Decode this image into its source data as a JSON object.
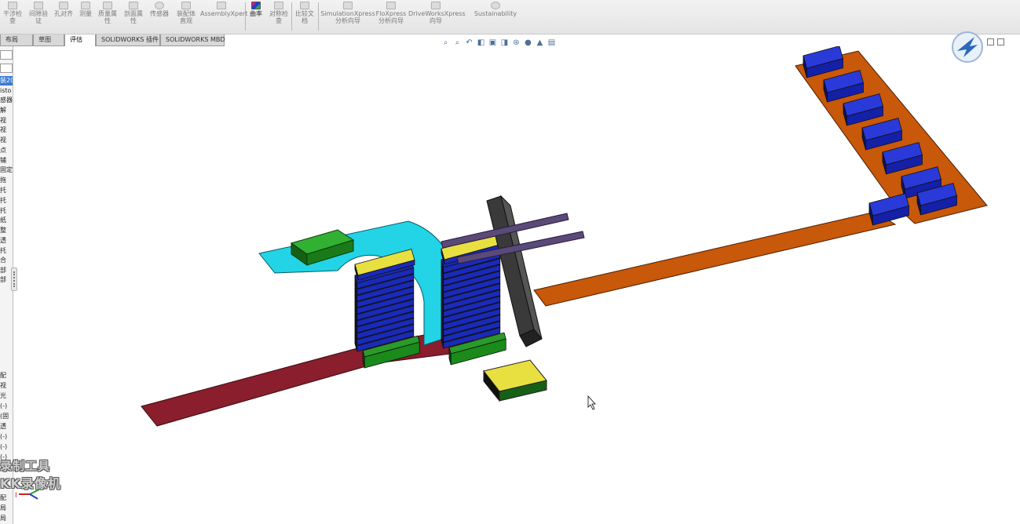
{
  "ribbon": {
    "tools": [
      {
        "id": "interference",
        "label": "干涉检\n查"
      },
      {
        "id": "clearance",
        "label": "间隙验\n证"
      },
      {
        "id": "hole-align",
        "label": "孔对齐"
      },
      {
        "id": "measure",
        "label": "测量"
      },
      {
        "id": "mass-props",
        "label": "质量属\n性"
      },
      {
        "id": "section-props",
        "label": "剖面属\n性"
      },
      {
        "id": "sensor",
        "label": "传感器"
      },
      {
        "id": "assembly-viz",
        "label": "装配体\n直观"
      },
      {
        "id": "assemblyxpert",
        "label": "AssemblyXpert"
      },
      {
        "id": "curvature",
        "label": "曲率"
      },
      {
        "id": "symmetry-check",
        "label": "对称检\n查"
      },
      {
        "id": "compare-docs",
        "label": "比较文\n档"
      },
      {
        "id": "simulationxpress",
        "label": "SimulationXpress\n分析向导"
      },
      {
        "id": "floxpress",
        "label": "FloXpress\n分析向导"
      },
      {
        "id": "driveworksxpress",
        "label": "DriveWorksXpress\n向导"
      },
      {
        "id": "sustainability",
        "label": "Sustainability"
      }
    ]
  },
  "tabs": [
    {
      "label": "布局",
      "active": false
    },
    {
      "label": "草图",
      "active": false
    },
    {
      "label": "评估",
      "active": true
    },
    {
      "label": "SOLIDWORKS 插件",
      "active": false
    },
    {
      "label": "SOLIDWORKS MBD",
      "active": false
    }
  ],
  "feature_tree": {
    "items_top": [
      "装20",
      "isto",
      "感器",
      "解",
      "视",
      "视",
      "视",
      "点",
      "辅",
      "固定",
      "拖",
      "托",
      "托",
      "托",
      "纸",
      "整",
      "透",
      "托",
      "合",
      "部",
      "部"
    ],
    "items_bottom": [
      "配",
      "视",
      "光",
      "(-)",
      "(固",
      "透",
      "(-)",
      "(-)",
      "(-)",
      "配",
      "局",
      "局"
    ]
  },
  "hud": {
    "icons": [
      "zoom-to-fit-icon",
      "zoom-area-icon",
      "previous-view-icon",
      "section-view-icon",
      "view-orientation-icon",
      "display-style-icon",
      "hide-show-icon",
      "edit-appearance-icon",
      "apply-scene-icon",
      "view-settings-icon"
    ]
  },
  "watermark": {
    "line1": "录制工具",
    "line2": "KK录像机"
  },
  "triad": {
    "axis_label": "I"
  },
  "colors": {
    "cyan_belt": "#22d4e6",
    "red_belt": "#8a1e2c",
    "orange_belt": "#c8580a",
    "pallet_yellow": "#e8e040",
    "pallet_blue": "#1a2ab8",
    "pallet_green": "#1a8a1a",
    "stacker_frame": "#3a3a3a",
    "arm_purple": "#5a4a78"
  }
}
